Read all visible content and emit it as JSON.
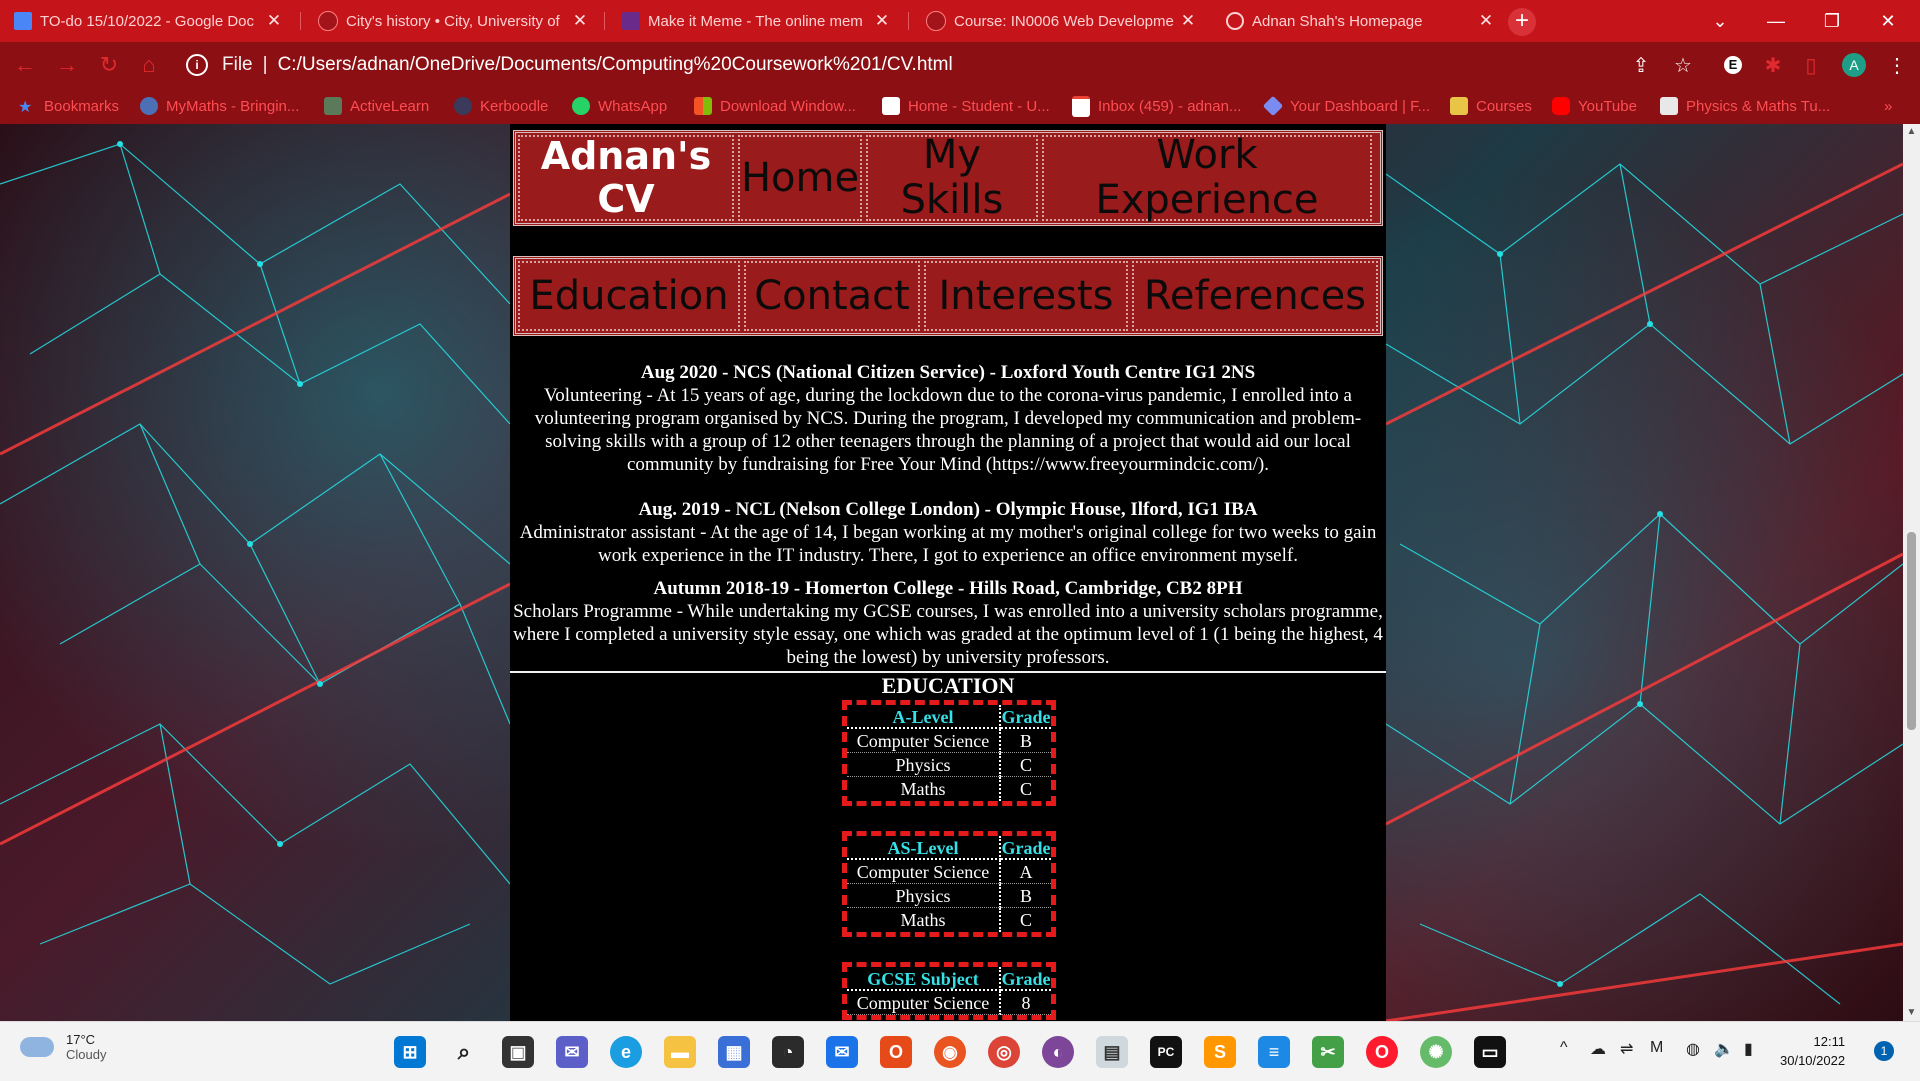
{
  "browser": {
    "tabs": [
      {
        "title": "TO-do 15/10/2022 - Google Doc",
        "icon": "google-docs-icon",
        "active": false
      },
      {
        "title": "City's history • City, University of",
        "icon": "city-university-icon",
        "active": false
      },
      {
        "title": "Make it Meme - The online mem",
        "icon": "meme-icon",
        "active": false
      },
      {
        "title": "Course: IN0006 Web Developme",
        "icon": "moodle-icon",
        "active": false
      },
      {
        "title": "Adnan Shah's Homepage",
        "icon": "globe-icon",
        "active": true
      }
    ],
    "address": {
      "scheme_label": "File",
      "url": "C:/Users/adnan/OneDrive/Documents/Computing%20Coursework%201/CV.html"
    },
    "bookmarks": [
      {
        "label": "Bookmarks",
        "icon": "star-icon"
      },
      {
        "label": "MyMaths - Bringin...",
        "icon": "mymaths-icon"
      },
      {
        "label": "ActiveLearn",
        "icon": "activelearn-icon"
      },
      {
        "label": "Kerboodle",
        "icon": "kerboodle-icon"
      },
      {
        "label": "WhatsApp",
        "icon": "whatsapp-icon"
      },
      {
        "label": "Download Window...",
        "icon": "windows-icon"
      },
      {
        "label": "Home - Student - U...",
        "icon": "unidays-icon"
      },
      {
        "label": "Inbox (459) - adnan...",
        "icon": "gmail-icon"
      },
      {
        "label": "Your Dashboard | F...",
        "icon": "dashboard-icon"
      },
      {
        "label": "Courses",
        "icon": "courses-icon"
      },
      {
        "label": "YouTube",
        "icon": "youtube-icon"
      },
      {
        "label": "Physics & Maths Tu...",
        "icon": "pmt-icon"
      }
    ],
    "bookmarks_overflow": "»",
    "theme_colors": {
      "tabbar": "#c6141b",
      "toolbar": "#8c0f14",
      "bookmark_text": "#ff4d52"
    }
  },
  "page": {
    "nav_row1": {
      "brand": "Adnan's CV",
      "links": [
        "Home",
        "My Skills",
        "Work Experience"
      ]
    },
    "nav_row2": {
      "links": [
        "Education",
        "Contact",
        "Interests",
        "References"
      ]
    },
    "experience": [
      {
        "heading": "Aug 2020 - NCS (National Citizen Service) - Loxford Youth Centre IG1 2NS",
        "body": "Volunteering - At 15 years of age, during the lockdown due to the corona-virus pandemic, I enrolled into a volunteering program organised by NCS. During the program, I developed my communication and problem-solving skills with a group of 12 other teenagers through the planning of a project that would aid our local community by fundraising for Free Your Mind (https://www.freeyourmindcic.com/)."
      },
      {
        "heading": "Aug. 2019 - NCL (Nelson College London) - Olympic House, Ilford, IG1 IBA",
        "body": "Administrator assistant - At the age of 14, I began working at my mother's original college for two weeks to gain work experience in the IT industry. There, I got to experience an office environment myself."
      },
      {
        "heading": "Autumn 2018-19 - Homerton College - Hills Road, Cambridge, CB2 8PH",
        "body": "Scholars Programme - While undertaking my GCSE courses, I was enrolled into a university scholars programme, where I completed a university style essay, one which was graded at the optimum level of 1 (1 being the highest, 4 being the lowest) by university professors."
      }
    ],
    "education": {
      "title": "EDUCATION",
      "tables": [
        {
          "header": [
            "A-Level",
            "Grade"
          ],
          "rows": [
            [
              "Computer Science",
              "B"
            ],
            [
              "Physics",
              "C"
            ],
            [
              "Maths",
              "C"
            ]
          ]
        },
        {
          "header": [
            "AS-Level",
            "Grade"
          ],
          "rows": [
            [
              "Computer Science",
              "A"
            ],
            [
              "Physics",
              "B"
            ],
            [
              "Maths",
              "C"
            ]
          ]
        },
        {
          "header": [
            "GCSE Subject",
            "Grade"
          ],
          "rows": [
            [
              "Computer Science",
              "8"
            ]
          ]
        }
      ]
    },
    "colors": {
      "nav_bg": "#9a1b1b",
      "table_border": "#e51b1b",
      "table_header": "#36e0e6"
    }
  },
  "taskbar": {
    "weather": {
      "temp": "17°C",
      "condition": "Cloudy"
    },
    "apps": [
      "start-icon",
      "search-icon",
      "task-view-icon",
      "teams-chat-icon",
      "edge-icon",
      "file-explorer-icon",
      "store-icon",
      "clock-app-icon",
      "mail-icon",
      "office-icon",
      "ubuntu-icon",
      "chrome-icon",
      "tor-icon",
      "files-icon",
      "pycharm-icon",
      "sublime-icon",
      "notepad-icon",
      "snip-icon",
      "opera-icon",
      "atom-icon",
      "terminal-icon"
    ],
    "time": "12:11",
    "date": "30/10/2022",
    "notifications": "1"
  }
}
